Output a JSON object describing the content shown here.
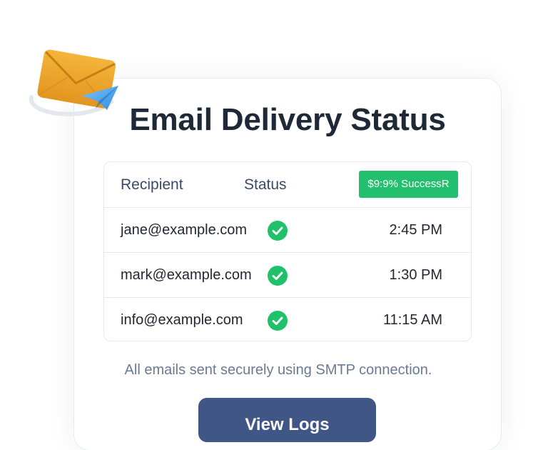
{
  "card": {
    "title": "Email Delivery Status",
    "footnote": "All emails sent securely using SMTP connection.",
    "button_label": "View Logs"
  },
  "table": {
    "columns": [
      "Recipient",
      "Status"
    ],
    "success_badge": "$9:9% SuccessR",
    "rows": [
      {
        "email": "jane@example.com",
        "status": "check-circle-icon",
        "time": "2:45 PM"
      },
      {
        "email": "mark@example.com",
        "status": "check-circle-icon",
        "time": "1:30 PM"
      },
      {
        "email": "info@example.com",
        "status": "check-circle-icon",
        "time": "11:15 AM"
      }
    ]
  },
  "icons": {
    "hero": "envelope-paper-plane-icon"
  },
  "colors": {
    "success": "#22c06e",
    "button": "#3f5686",
    "title": "#1e2836",
    "header_text": "#3b4a66",
    "footnote": "#6a7b91",
    "envelope": "#f0a830"
  }
}
